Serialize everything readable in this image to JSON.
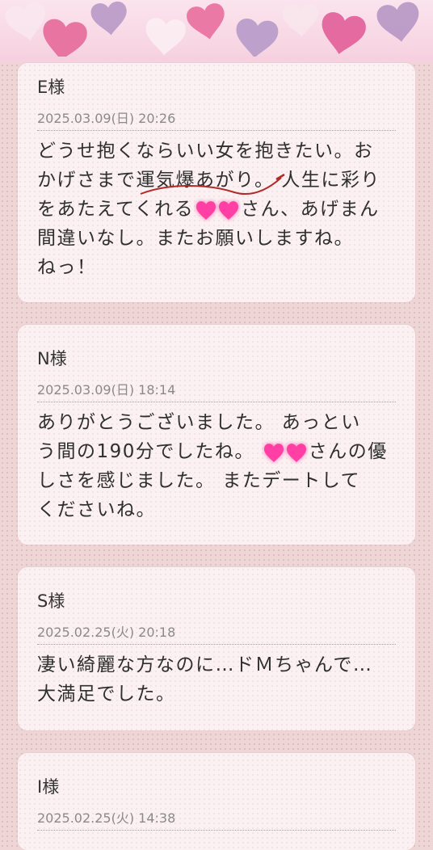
{
  "header": {
    "hearts": [
      {
        "icon": "heart-icon",
        "color": "#f8e6ee"
      },
      {
        "icon": "heart-icon",
        "color": "#e56b9b"
      },
      {
        "icon": "heart-icon",
        "color": "#b89ac8"
      },
      {
        "icon": "heart-icon",
        "color": "#fbeef2"
      },
      {
        "icon": "heart-icon",
        "color": "#e9709f"
      },
      {
        "icon": "heart-icon",
        "color": "#b79bc9"
      },
      {
        "icon": "heart-icon",
        "color": "#f9e5ec"
      },
      {
        "icon": "heart-icon",
        "color": "#e2619a"
      },
      {
        "icon": "heart-icon",
        "color": "#b798c6"
      }
    ]
  },
  "reviews": [
    {
      "name": "E様",
      "date": "2025.03.09(日) 20:26",
      "lines": [
        [
          "どうせ抱くならいい女を抱きたい。お"
        ],
        [
          "かげさまで運気爆あがり。 人生に彩り"
        ],
        [
          "をあたえてくれる",
          "♥",
          "さん、あげまん"
        ],
        [
          "間違いなし。またお願いしますね。"
        ],
        [
          "ねっ！"
        ]
      ]
    },
    {
      "name": "N様",
      "date": "2025.03.09(日) 18:14",
      "lines": [
        [
          "ありがとうございました。 あっとい"
        ],
        [
          "う間の190分でしたね。 ",
          "♥",
          "さんの優"
        ],
        [
          "しさを感じました。 またデートして"
        ],
        [
          "くださいね。"
        ]
      ]
    },
    {
      "name": "S様",
      "date": "2025.02.25(火) 20:18",
      "lines": [
        [
          "凄い綺麗な方なのに…ドＭちゃんで…"
        ],
        [
          "大満足でした。"
        ]
      ]
    },
    {
      "name": "I様",
      "date": "2025.02.25(火) 14:38",
      "lines": []
    }
  ],
  "colors": {
    "accent_heart": "#ff3fa4",
    "annotation": "#b02a2a"
  }
}
